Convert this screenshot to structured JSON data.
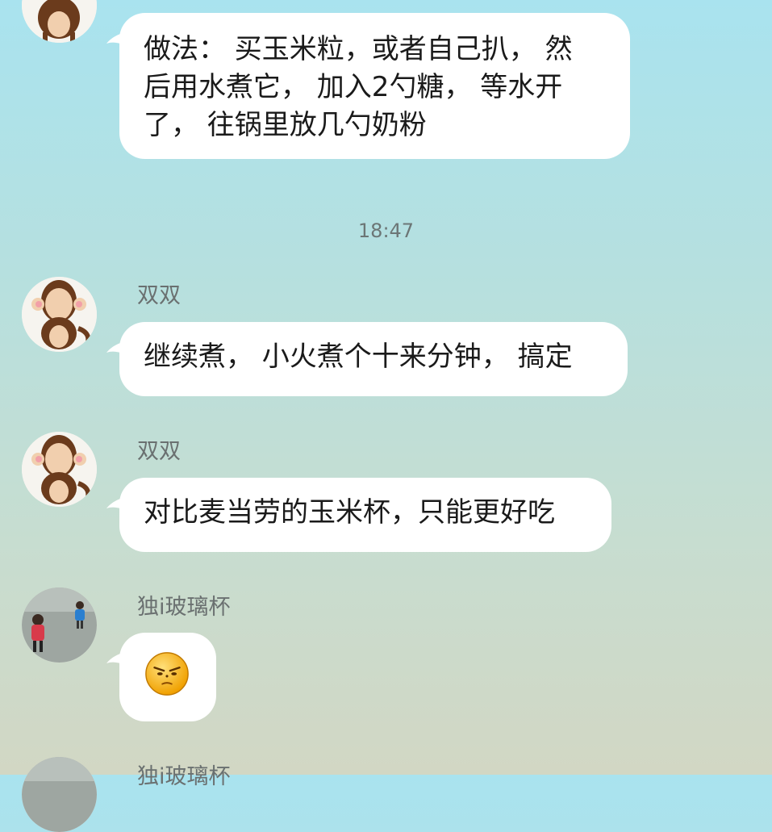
{
  "messages": [
    {
      "sender": "",
      "lines": [
        "做法： 买玉米粒，或者自己扒， 然",
        "后用水煮它， 加入2勺糖， 等水开",
        "了， 往锅里放几勺奶粉"
      ]
    },
    {
      "sender": "双双",
      "text": "继续煮， 小火煮个十来分钟， 搞定"
    },
    {
      "sender": "双双",
      "text": "对比麦当劳的玉米杯，只能更好吃"
    },
    {
      "sender": "独i玻璃杯",
      "emoji": "angry-face-emoji"
    },
    {
      "sender": "独i玻璃杯"
    }
  ],
  "timestamp": "18:47",
  "icons": {
    "monkey_avatar": "monkey-avatar",
    "kids_avatar": "kids-photo-avatar"
  }
}
